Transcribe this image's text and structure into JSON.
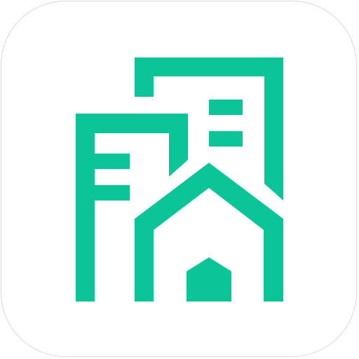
{
  "app_icon": {
    "icon_name": "buildings-with-home-logo",
    "background_color": "#ffffff",
    "border_color": "#d9d9d9",
    "brand_color": "#0bc497"
  }
}
